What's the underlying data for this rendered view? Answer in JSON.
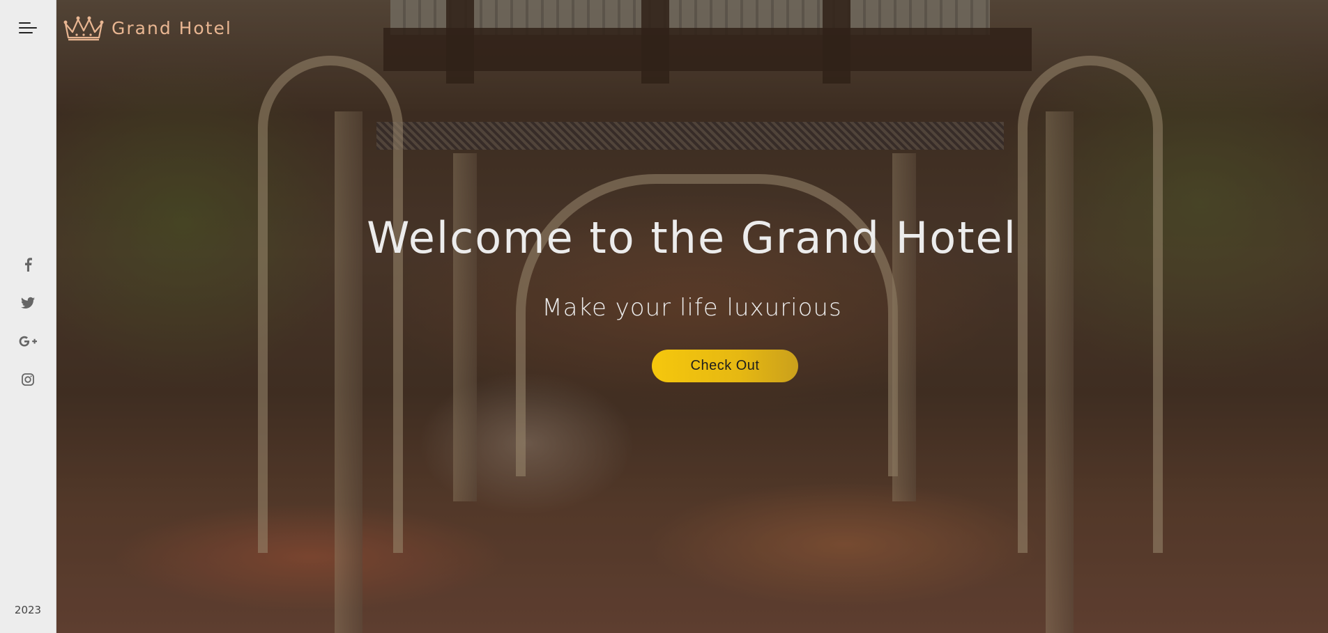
{
  "brand": {
    "name": "Grand Hotel",
    "logo_icon": "crown-icon",
    "logo_color": "#e9b692"
  },
  "sidebar": {
    "menu_icon": "hamburger-menu-icon",
    "socials": [
      {
        "name": "facebook",
        "icon": "facebook-icon"
      },
      {
        "name": "twitter",
        "icon": "twitter-icon"
      },
      {
        "name": "google-plus",
        "icon": "google-plus-icon"
      },
      {
        "name": "instagram",
        "icon": "instagram-icon"
      }
    ],
    "year": "2023"
  },
  "hero": {
    "title": "Welcome to the Grand Hotel",
    "subtitle": "Make your life luxurious",
    "cta_label": "Check Out",
    "cta_color": "#f5c70d"
  }
}
